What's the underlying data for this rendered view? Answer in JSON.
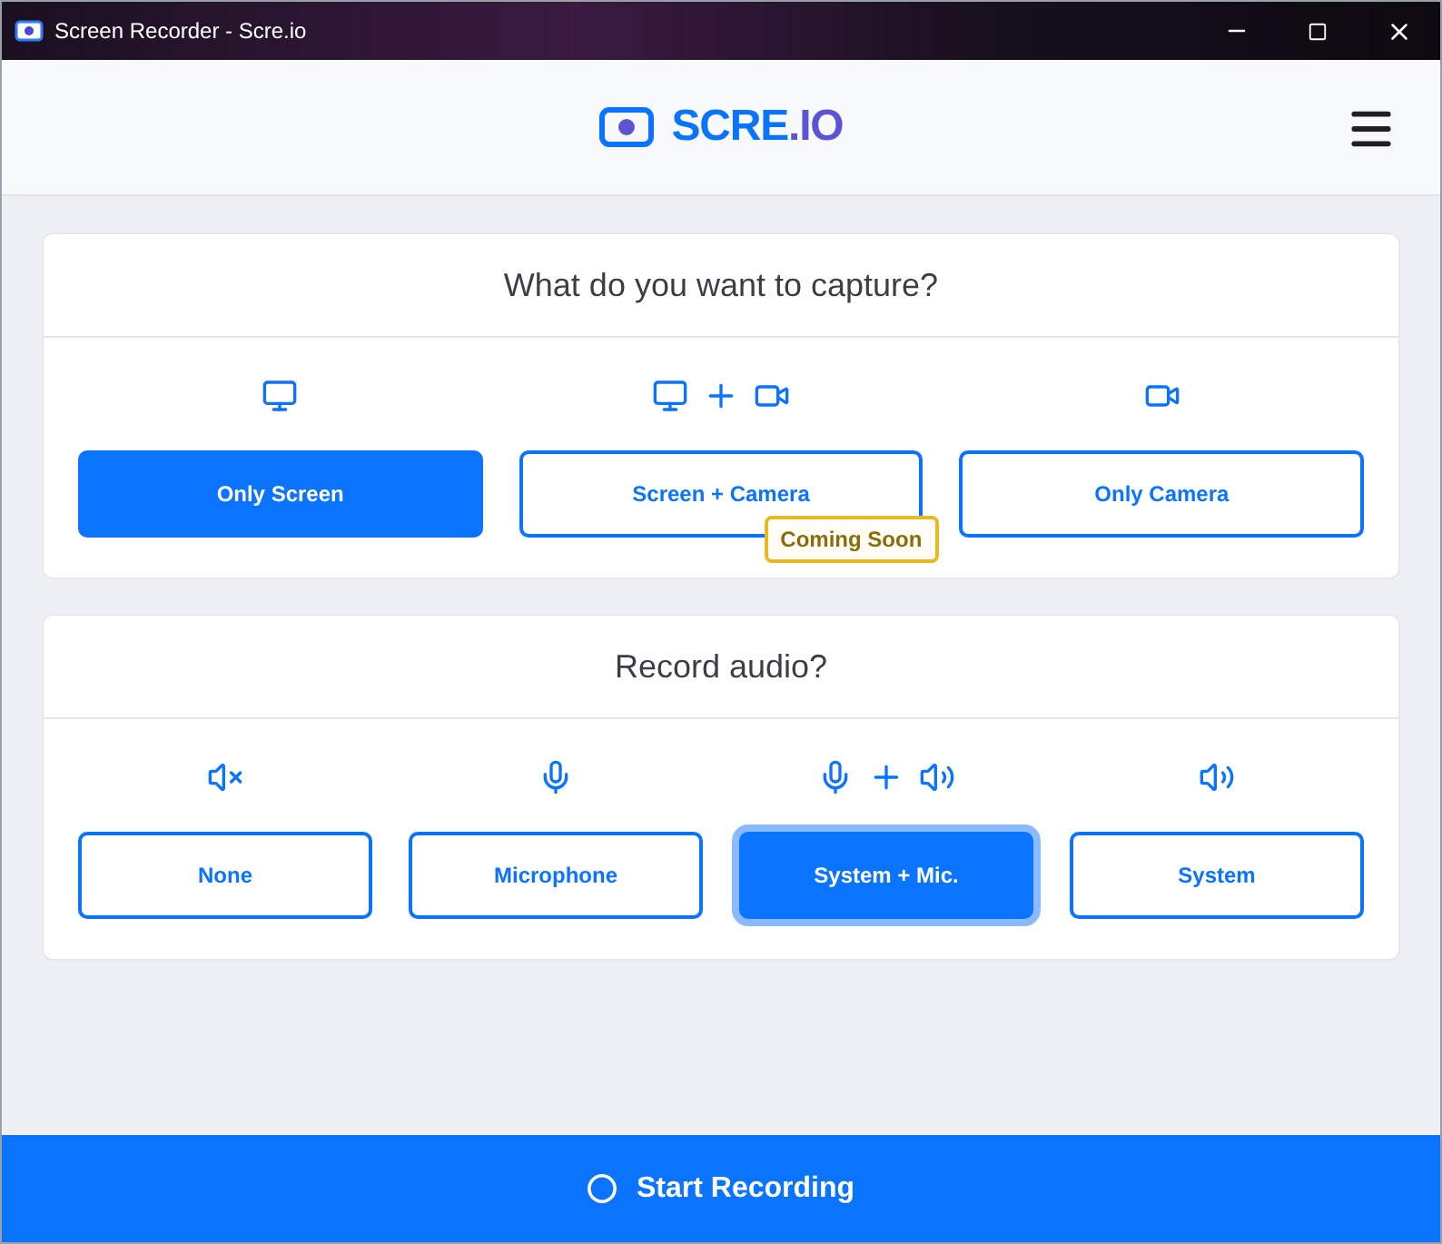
{
  "window": {
    "title": "Screen Recorder - Scre.io"
  },
  "header": {
    "logo_main": "SCRE",
    "logo_accent": ".IO"
  },
  "capture": {
    "title": "What do you want to capture?",
    "options": [
      {
        "kind": "screen",
        "label": "Only Screen",
        "selected": true
      },
      {
        "kind": "screen_camera",
        "label": "Screen + Camera",
        "selected": false,
        "badge": "Coming Soon"
      },
      {
        "kind": "camera",
        "label": "Only Camera",
        "selected": false
      }
    ]
  },
  "audio": {
    "title": "Record audio?",
    "options": [
      {
        "kind": "none",
        "label": "None",
        "selected": false,
        "focused": false
      },
      {
        "kind": "mic",
        "label": "Microphone",
        "selected": false,
        "focused": false
      },
      {
        "kind": "mic_system",
        "label": "System + Mic.",
        "selected": true,
        "focused": true
      },
      {
        "kind": "system",
        "label": "System",
        "selected": false,
        "focused": false
      }
    ]
  },
  "footer": {
    "button": "Start Recording"
  }
}
